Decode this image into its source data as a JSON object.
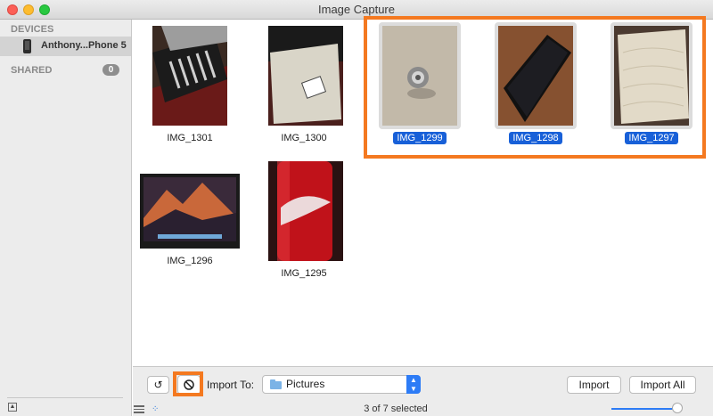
{
  "window": {
    "title": "Image Capture"
  },
  "sidebar": {
    "devices_heading": "DEVICES",
    "device_name": "Anthony...Phone 5",
    "shared_heading": "SHARED",
    "shared_count": "0"
  },
  "photos": [
    {
      "name": "IMG_1301",
      "selected": false
    },
    {
      "name": "IMG_1300",
      "selected": false
    },
    {
      "name": "IMG_1299",
      "selected": true
    },
    {
      "name": "IMG_1298",
      "selected": true
    },
    {
      "name": "IMG_1297",
      "selected": true
    },
    {
      "name": "IMG_1296",
      "selected": false
    },
    {
      "name": "IMG_1295",
      "selected": false
    }
  ],
  "toolbar": {
    "rotate_label": "↺",
    "import_to_label": "Import To:",
    "import_to_value": "Pictures",
    "import_label": "Import",
    "import_all_label": "Import All",
    "status": "3 of 7 selected"
  },
  "colors": {
    "selection": "#1860d8",
    "annotation": "#f47920",
    "accent": "#2d7cf6"
  }
}
